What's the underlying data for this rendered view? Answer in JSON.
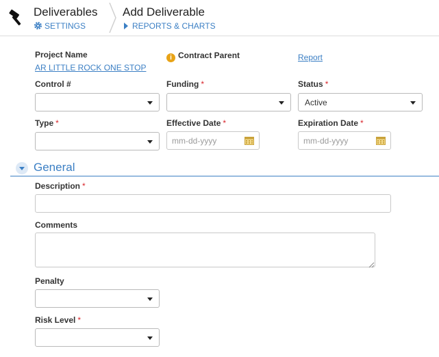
{
  "header": {
    "title": "Deliverables",
    "settings_label": "SETTINGS",
    "page_title": "Add Deliverable",
    "reports_label": "REPORTS & CHARTS"
  },
  "project": {
    "label": "Project Name",
    "value": "AR LITTLE ROCK ONE STOP",
    "contract_parent_label": "Contract Parent",
    "report_link": "Report"
  },
  "fields": {
    "control": {
      "label": "Control #",
      "value": ""
    },
    "funding": {
      "label": "Funding",
      "required": "*",
      "value": ""
    },
    "status": {
      "label": "Status",
      "required": "*",
      "value": "Active"
    },
    "type": {
      "label": "Type",
      "required": "*",
      "value": ""
    },
    "effective_date": {
      "label": "Effective Date",
      "required": "*",
      "placeholder": "mm-dd-yyyy"
    },
    "expiration_date": {
      "label": "Expiration Date",
      "required": "*",
      "placeholder": "mm-dd-yyyy"
    }
  },
  "general": {
    "title": "General",
    "description": {
      "label": "Description",
      "required": "*",
      "value": ""
    },
    "comments": {
      "label": "Comments",
      "value": ""
    },
    "penalty": {
      "label": "Penalty",
      "value": ""
    },
    "risk_level": {
      "label": "Risk Level",
      "required": "*",
      "value": ""
    }
  },
  "colors": {
    "accent": "#3b7fc4",
    "required": "#d9262c",
    "info_icon": "#e8a317"
  }
}
